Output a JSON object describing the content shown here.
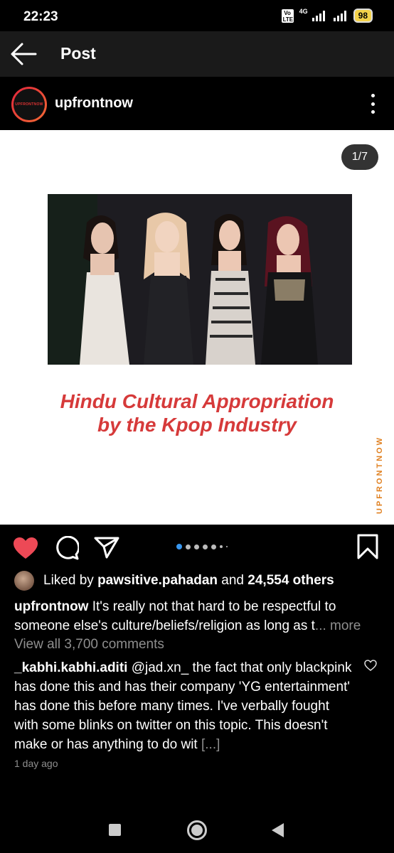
{
  "status_bar": {
    "time": "22:23",
    "volte": "Vo LTE",
    "network": "4G",
    "battery": "98"
  },
  "header": {
    "title": "Post",
    "back_icon": "back-arrow-icon"
  },
  "post": {
    "username": "upfrontnow",
    "avatar_text": "UPFRONTNOW",
    "page_counter": "1/7",
    "image": {
      "headline_line1": "Hindu Cultural Appropriation",
      "headline_line2": "by the Kpop Industry",
      "watermark": "UPFRONTNOW"
    },
    "carousel": {
      "total": 7,
      "active": 1
    },
    "likes": {
      "prefix": "Liked by",
      "user": "pawsitive.pahadan",
      "joiner": "and",
      "others": "24,554 others"
    },
    "caption": {
      "username": "upfrontnow",
      "text": "It's really not that hard to be respectful to someone else's culture/beliefs/religion as long as t",
      "more": "... more"
    },
    "view_comments": "View all 3,700 comments",
    "comment": {
      "username": "_kabhi.kabhi.aditi",
      "text": "@jad.xn_ the fact that only blackpink has done this and has their company 'YG entertainment' has done this before many times. I've verbally fought with some blinks on twitter on this topic. This doesn't make or has anything to do wit",
      "truncation": "[...]",
      "time": "1 day ago"
    }
  },
  "colors": {
    "like_red": "#ed4956",
    "headline_red": "#d63a3a",
    "watermark_orange": "#e08020",
    "carousel_active": "#3897f0",
    "muted": "#8e8e8e"
  }
}
